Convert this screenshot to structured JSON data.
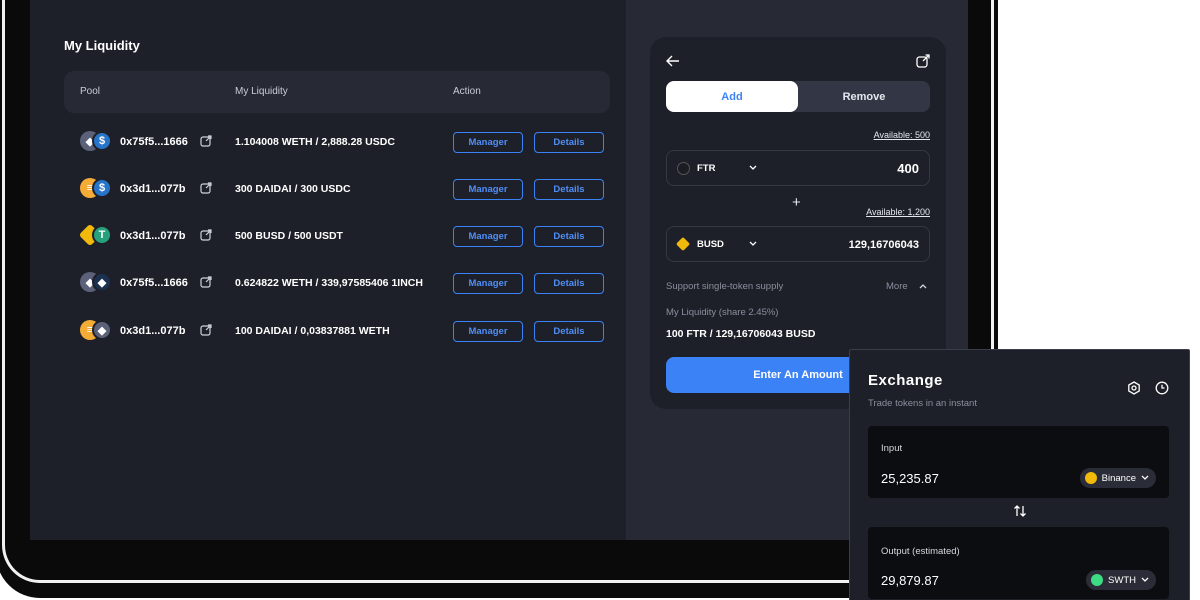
{
  "liquidity": {
    "title": "My Liquidity",
    "columns": {
      "pool": "Pool",
      "my_liquidity": "My Liquidity",
      "action": "Action"
    },
    "rows": [
      {
        "address": "0x75f5...1666",
        "liquidity": "1.104008 WETH / 2,888.28 USDC",
        "tokens": [
          "eth",
          "usdc"
        ]
      },
      {
        "address": "0x3d1...077b",
        "liquidity": "300 DAIDAI / 300 USDC",
        "tokens": [
          "dai",
          "usdc"
        ]
      },
      {
        "address": "0x3d1...077b",
        "liquidity": "500 BUSD / 500 USDT",
        "tokens": [
          "busd",
          "usdt"
        ]
      },
      {
        "address": "0x75f5...1666",
        "liquidity": "0.624822 WETH / 339,97585406 1INCH",
        "tokens": [
          "eth",
          "1inch"
        ]
      },
      {
        "address": "0x3d1...077b",
        "liquidity": "100 DAIDAI / 0,03837881 WETH",
        "tokens": [
          "dai",
          "eth"
        ]
      }
    ],
    "manager_label": "Manager",
    "details_label": "Details"
  },
  "add_panel": {
    "tab_add": "Add",
    "tab_remove": "Remove",
    "available_1": "Available: 500",
    "token1_symbol": "FTR",
    "token1_amount": "400",
    "plus": "+",
    "available_2": "Available: 1,200",
    "token2_symbol": "BUSD",
    "token2_amount": "129,16706043",
    "support_text": "Support single-token supply",
    "more_label": "More",
    "share_text": "My Liquidity (share 2.45%)",
    "share_amount": "100 FTR /  129,16706043 BUSD",
    "enter_button": "Enter An Amount"
  },
  "exchange": {
    "title": "Exchange",
    "subtitle": "Trade tokens in an instant",
    "input_label": "Input",
    "input_value": "25,235.87",
    "input_token": "Binance",
    "output_label": "Output (estimated)",
    "output_value": "29,879.87",
    "output_token": "SWTH"
  },
  "icons": {
    "back": "arrow-left-icon",
    "external": "external-link-icon",
    "settings": "settings-icon",
    "history": "clock-icon",
    "swap": "swap-arrows-icon"
  },
  "colors": {
    "accent": "#3b82f6",
    "bg": "#1e2029",
    "panel": "#272a34"
  }
}
